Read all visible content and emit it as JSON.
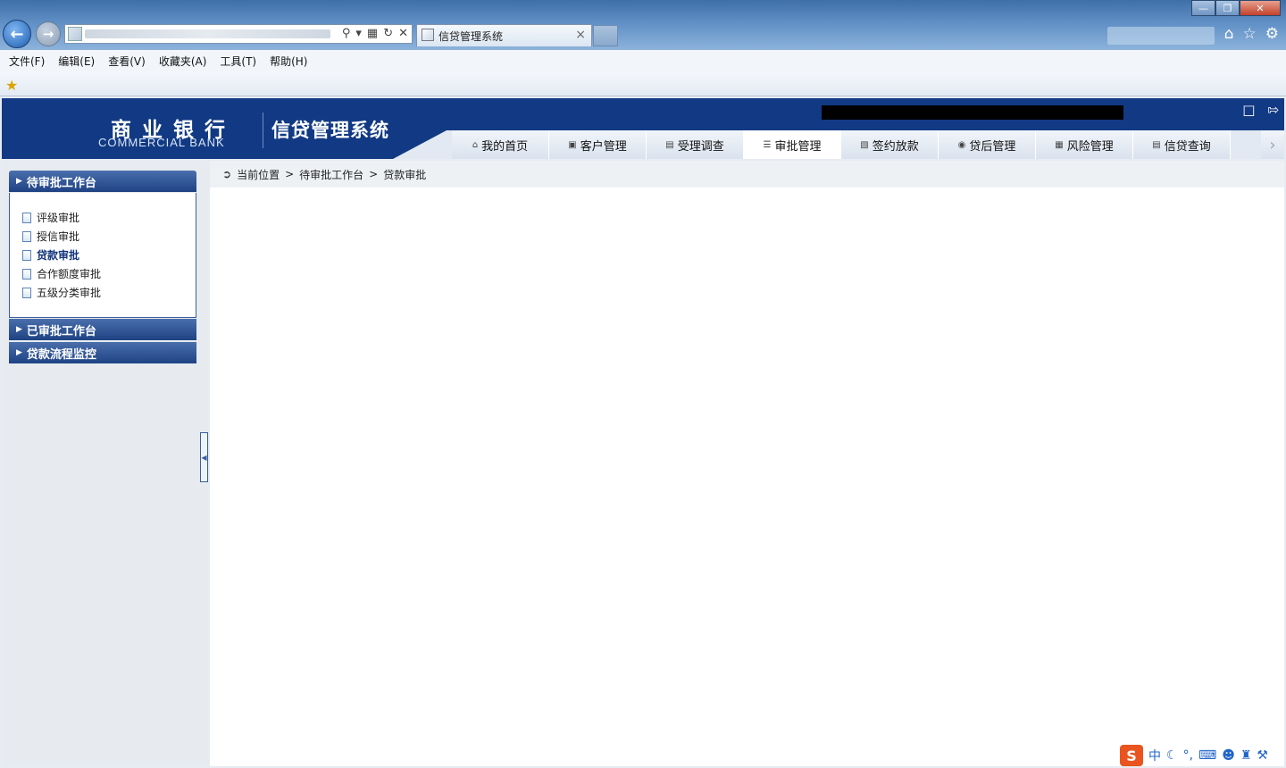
{
  "browser": {
    "tab_title": "信贷管理系统",
    "menu": [
      "文件(F)",
      "编辑(E)",
      "查看(V)",
      "收藏夹(A)",
      "工具(T)",
      "帮助(H)"
    ]
  },
  "header": {
    "bank_cn": "商业银行",
    "bank_en": "COMMERCIAL BANK",
    "system_title": "信贷管理系统"
  },
  "nav": {
    "tabs": [
      {
        "label": "我的首页",
        "icon": "home-icon"
      },
      {
        "label": "客户管理",
        "icon": "customer-icon"
      },
      {
        "label": "受理调查",
        "icon": "survey-icon"
      },
      {
        "label": "审批管理",
        "icon": "approval-icon",
        "active": true
      },
      {
        "label": "签约放款",
        "icon": "contract-icon"
      },
      {
        "label": "贷后管理",
        "icon": "postloan-icon"
      },
      {
        "label": "风险管理",
        "icon": "risk-icon"
      },
      {
        "label": "信贷查询",
        "icon": "query-icon"
      }
    ]
  },
  "sidebar": {
    "panel1_title": "待审批工作台",
    "items": [
      "评级审批",
      "授信审批",
      "贷款审批",
      "合作额度审批",
      "五级分类审批"
    ],
    "selected": "贷款审批",
    "panel2_title": "已审批工作台",
    "panel3_title": "贷款流程监控"
  },
  "breadcrumb": {
    "current_label": "当前位置",
    "sep1": ">",
    "level1": "待审批工作台",
    "sep2": ">",
    "level2": "贷款审批"
  },
  "ime": {
    "lang": "中"
  },
  "colors": {
    "header_bg": "#123a84",
    "panel_head": "#1f4283",
    "sidebar_bg": "#e7ebf0",
    "ime_brand": "#e9541f"
  }
}
